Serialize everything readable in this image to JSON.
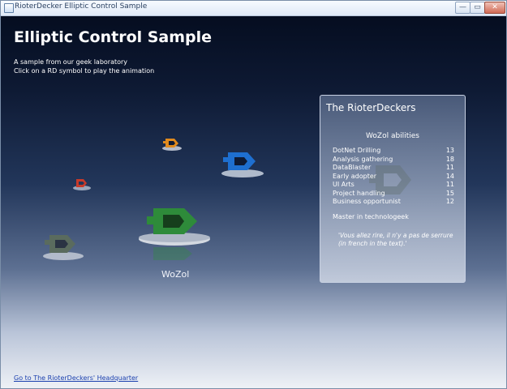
{
  "window": {
    "title": "RioterDecker Elliptic Control Sample",
    "min_label": "—",
    "max_label": "▭",
    "close_label": "✕"
  },
  "header": {
    "title": "Elliptic Control Sample",
    "line1": "A sample from our geek laboratory",
    "line2": "Click on a RD symbol to play the animation"
  },
  "carousel": {
    "selected_name": "WoZol",
    "items": [
      {
        "name": "orange-rd",
        "color": "#e08a1e"
      },
      {
        "name": "blue-rd",
        "color": "#1e6fd0"
      },
      {
        "name": "red-rd",
        "color": "#c83a2a"
      },
      {
        "name": "green-rd",
        "color": "#2e8b3a"
      },
      {
        "name": "gray-rd",
        "color": "#5a6b5e"
      }
    ]
  },
  "panel": {
    "title": "The RioterDeckers",
    "subtitle": "WoZol abilities",
    "abilities": [
      {
        "name": "DotNet Drilling",
        "value": "13"
      },
      {
        "name": "Analysis gathering",
        "value": "18"
      },
      {
        "name": "DataBlaster",
        "value": "11"
      },
      {
        "name": "Early adopter",
        "value": "14"
      },
      {
        "name": "UI Arts",
        "value": "11"
      },
      {
        "name": "Project handling",
        "value": "15"
      },
      {
        "name": "Business opportunist",
        "value": "12"
      }
    ],
    "master": "Master in technologeek",
    "quote": "'Vous allez rire, il n'y a pas de serrure (in french in the text).'"
  },
  "footer": {
    "link": "Go to The RioterDeckers' Headquarter"
  }
}
